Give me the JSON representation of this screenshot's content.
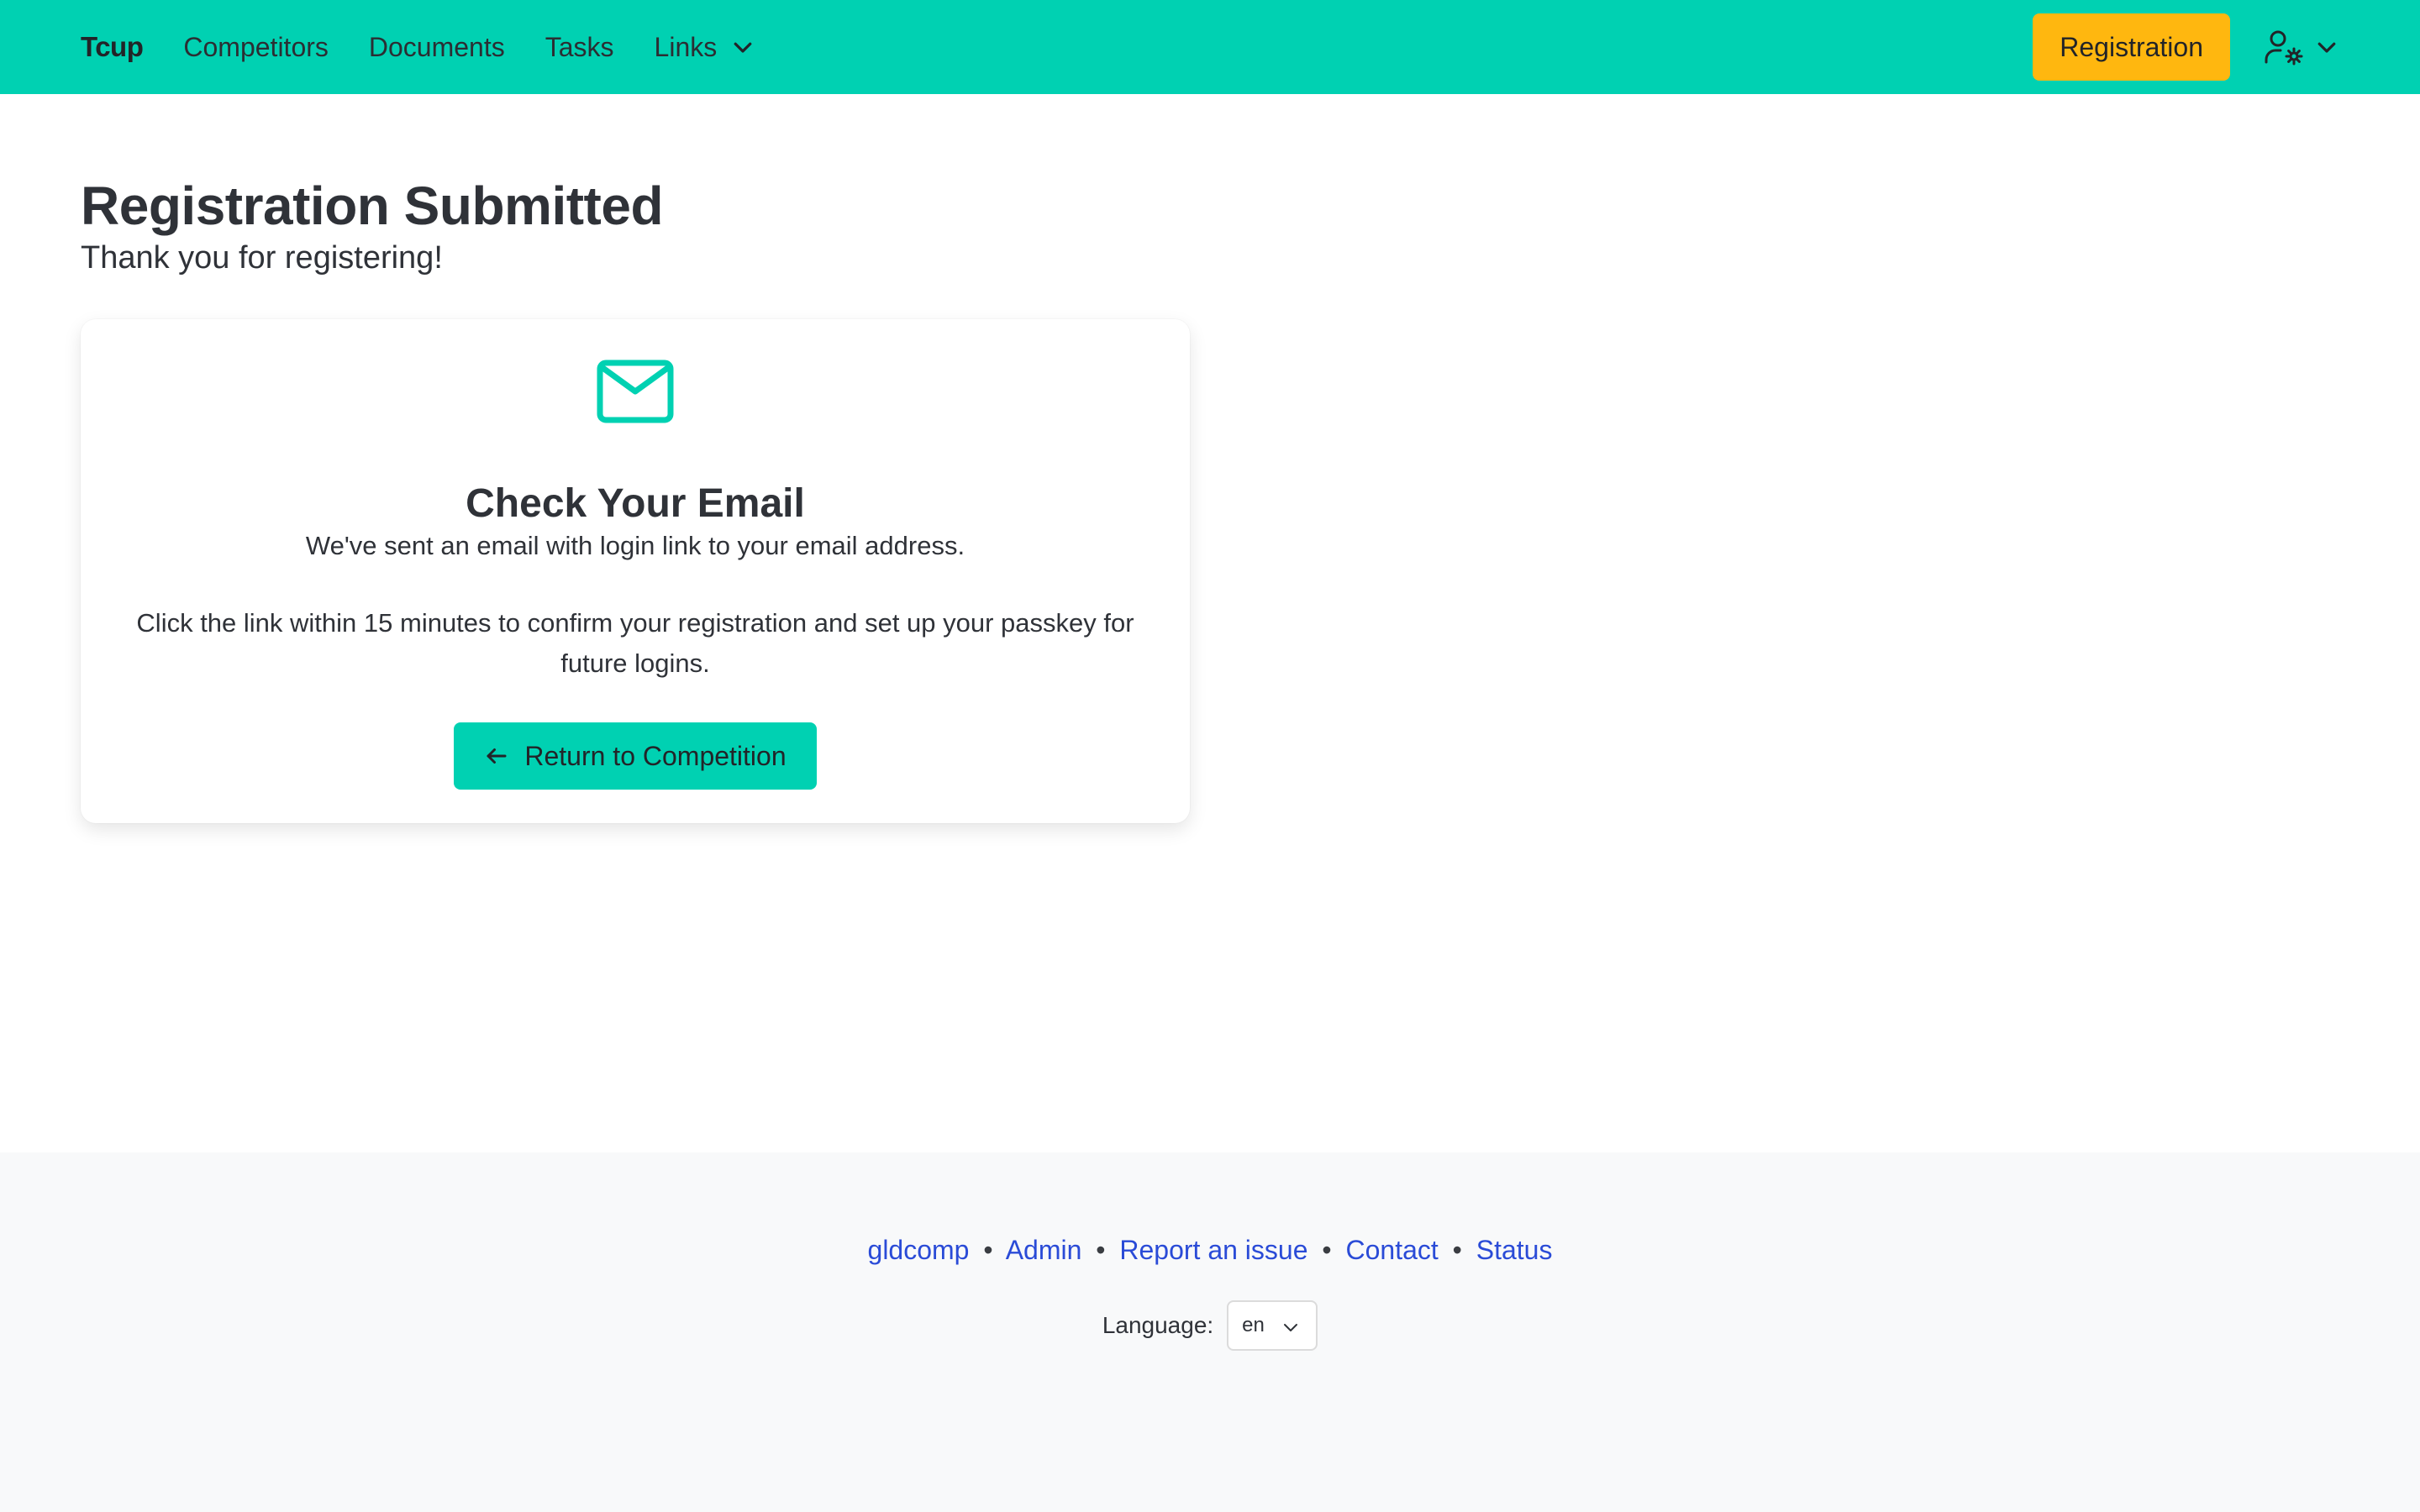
{
  "navbar": {
    "brand": "Tcup",
    "items": [
      {
        "label": "Competitors"
      },
      {
        "label": "Documents"
      },
      {
        "label": "Tasks"
      },
      {
        "label": "Links",
        "has_dropdown": true
      }
    ],
    "registration_button": "Registration",
    "user_menu_icon": "user-gear-icon",
    "bg_color": "#00d1b2",
    "button_color": "#ffb70f"
  },
  "main": {
    "title": "Registration Submitted",
    "subtitle": "Thank you for registering!"
  },
  "card": {
    "icon": "envelope-icon",
    "title": "Check Your Email",
    "line1": "We've sent an email with login link to your email address.",
    "line2": "Click the link within 15 minutes to confirm your registration and set up your passkey for future logins.",
    "button_label": "Return to Competition",
    "button_icon": "arrow-left-icon",
    "accent_color": "#00d1b2"
  },
  "footer": {
    "links": [
      "gldcomp",
      "Admin",
      "Report an issue",
      "Contact",
      "Status"
    ],
    "separator": "•",
    "language_label": "Language:",
    "language_value": "en",
    "link_color": "#2a4bd7"
  }
}
